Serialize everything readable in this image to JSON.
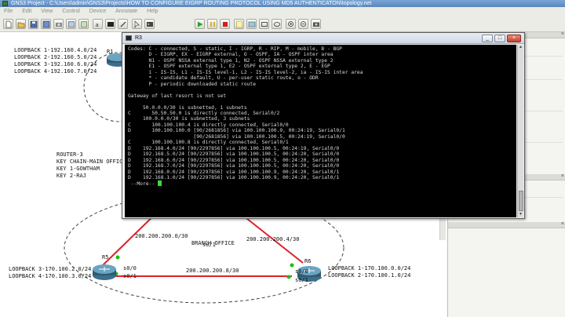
{
  "window": {
    "title": "GNS3 Project - C:\\Users\\admin\\GNS3\\Projects\\HOW TO CONFIGURE EIGRP ROUTING PROTOCOL USING MD5 AUTHENTICATON\\topology.net"
  },
  "menu": [
    "File",
    "Edit",
    "View",
    "Control",
    "Device",
    "Annotate",
    "Help"
  ],
  "toolbar": {
    "icons": [
      "new-project-icon",
      "open-project-icon",
      "save-project-icon",
      "save-as-icon",
      "snapshot-icon",
      "import-icon",
      "export-icon",
      "show-labels-icon",
      "console-all-icon",
      "add-link-icon",
      "select-icon",
      "console-icon",
      "start-icon",
      "pause-icon",
      "stop-icon",
      "note-icon",
      "picture-icon",
      "rectangle-icon",
      "ellipse-icon",
      "zoom-in-icon",
      "zoom-out-icon",
      "screenshot-icon"
    ]
  },
  "terminal": {
    "title": "R3",
    "lines": [
      "Codes: C - connected, S - static, I - IGRP, R - RIP, M - mobile, B - BGP",
      "       D - EIGRP, EX - EIGRP external, O - OSPF, IA - OSPF inter area",
      "       N1 - OSPF NSSA external type 1, N2 - OSPF NSSA external type 2",
      "       E1 - OSPF external type 1, E2 - OSPF external type 2, E - EGP",
      "       i - IS-IS, L1 - IS-IS level-1, L2 - IS-IS level-2, ia - IS-IS inter area",
      "       * - candidate default, U - per-user static route, o - ODR",
      "       P - periodic downloaded static route",
      "",
      "Gateway of last resort is not set",
      "",
      "     50.0.0.0/30 is subnetted, 1 subnets",
      "C       50.50.50.0 is directly connected, Serial0/2",
      "     100.0.0.0/30 is subnetted, 3 subnets",
      "C       100.100.100.4 is directly connected, Serial0/0",
      "D       100.100.100.0 [90/2681856] via 100.100.100.9, 00:24:19, Serial0/1",
      "                      [90/2681856] via 100.100.100.5, 00:24:19, Serial0/0",
      "C       100.100.100.8 is directly connected, Serial0/1",
      "D    192.168.4.0/24 [90/2297856] via 100.100.100.5, 00:24:19, Serial0/0",
      "D    192.168.5.0/24 [90/2297856] via 100.100.100.5, 00:24:20, Serial0/0",
      "D    192.168.6.0/24 [90/2297856] via 100.100.100.5, 00:24:20, Serial0/0",
      "D    192.168.7.0/24 [90/2297856] via 100.100.100.5, 00:24:20, Serial0/0",
      "D    192.168.0.0/24 [90/2297856] via 100.100.100.9, 00:24:20, Serial0/1",
      "D    192.168.1.0/24 [90/2297856] via 100.100.100.9, 00:24:20, Serial0/1"
    ],
    "prompt": " --More-- "
  },
  "topology": {
    "r1_label": "R1",
    "r1_loopbacks": [
      "LOOPBACK 1-192.160.4.0/24",
      "LOOPBACK 2-192.160.5.0/24",
      "LOOPBACK 3-192.160.6.0/24",
      "LOOPBACK 4-192.160.7.0/24"
    ],
    "r3_notes": [
      "ROUTER-3",
      "KEY CHAIN-MAIN OFFICE",
      "KEY 1-GOWTHAM",
      "KEY 2-RAJ"
    ],
    "branch_office": "BRANCH OFFICE",
    "r5_label": "R5",
    "r5_loopbacks": [
      "LOOPBACK 3-170.100.2.0/24",
      "LOOPBACK 4-170.100.3.0/24"
    ],
    "r6_label": "R6",
    "r6_loopbacks": [
      "LOOPBACK 1-170.100.0.0/24",
      "LOOPBACK 2-170.100.1.0/24"
    ],
    "links": {
      "r5_top_net": "200.200.200.0/30",
      "r6_top_net": "200.200.200.4/30",
      "r5_r6_net": "200.200.200.8/30"
    },
    "interfaces": {
      "r5_top": "s0/0",
      "r5_bottom": "s0/1",
      "r6_top": "s0/0",
      "r6_bottom": "s0/1",
      "top_if": "s0/1"
    }
  },
  "colors": {
    "terminal_bg": "#000000",
    "terminal_text": "#d8d8d8",
    "link_red": "#e0202a",
    "cursor_green": "#33dd33"
  }
}
